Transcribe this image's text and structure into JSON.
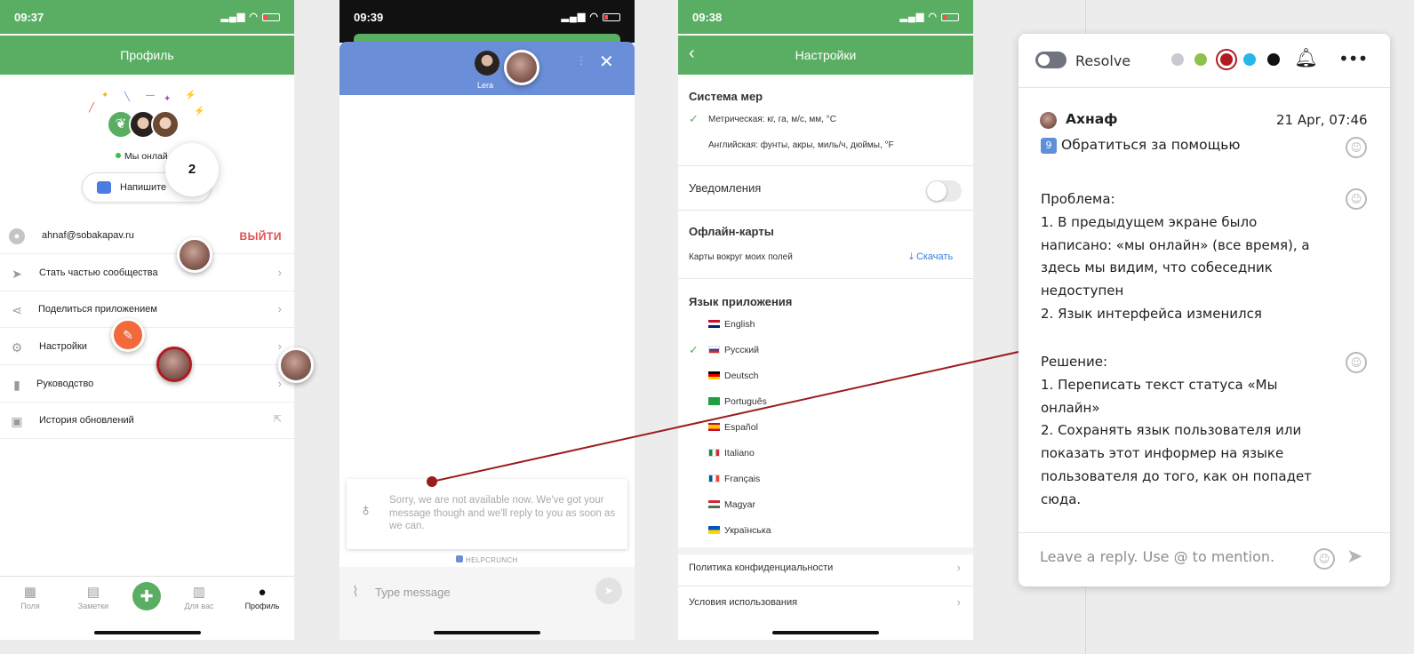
{
  "screen1": {
    "time": "09:37",
    "title": "Профиль",
    "online": "Мы онлай",
    "write_button": "Напишите",
    "badge": "2",
    "email": "ahnaf@sobakapav.ru",
    "logout": "ВЫЙТИ",
    "menu": [
      {
        "label": "Стать частью сообщества",
        "icon": "paper-plane-icon"
      },
      {
        "label": "Поделиться приложением",
        "icon": "share-icon"
      },
      {
        "label": "Настройки",
        "icon": "gear-icon"
      },
      {
        "label": "Руководство",
        "icon": "book-icon"
      },
      {
        "label": "История обновлений",
        "icon": "box-icon"
      }
    ],
    "tabs": [
      {
        "label": "Поля",
        "icon": "fields-icon"
      },
      {
        "label": "Заметки",
        "icon": "notes-icon"
      },
      {
        "label": "",
        "icon": "add-icon"
      },
      {
        "label": "Для вас",
        "icon": "for-you-icon"
      },
      {
        "label": "Профиль",
        "icon": "profile-icon"
      }
    ]
  },
  "screen2": {
    "time": "09:39",
    "agent_name": "Lera",
    "notice": "Sorry, we are not available now. We've got your message though and we'll reply to you as soon as we can.",
    "powered": "HELPCRUNCH",
    "input_placeholder": "Type message"
  },
  "screen3": {
    "time": "09:38",
    "title": "Настройки",
    "units_title": "Система мер",
    "units_metric": "Метрическая: кг, га, м/с, мм, °C",
    "units_imperial": "Английская: фунты, акры, миль/ч, дюймы, °F",
    "notifications": "Уведомления",
    "offline_maps": "Офлайн-карты",
    "maps_around": "Карты вокруг моих полей",
    "download": "Скачать",
    "lang_title": "Язык приложения",
    "languages": [
      "English",
      "Русский",
      "Deutsch",
      "Português",
      "Español",
      "Italiano",
      "Français",
      "Magyar",
      "Українська"
    ],
    "privacy": "Политика конфиденциальности",
    "terms": "Условия использования"
  },
  "comment": {
    "resolve": "Resolve",
    "author": "Ахнаф",
    "date": "21 Apr, 07:46",
    "number_emoji": "9",
    "subject": "Обратиться за помощью",
    "problem": [
      "Проблема:",
      "1. В предыдущем экране было",
      "написано: «мы онлайн» (все время), а",
      "здесь мы видим, что собеседник",
      "недоступен",
      "2. Язык интерфейса изменился"
    ],
    "solution": [
      "Решение:",
      "1. Переписать текст статуса «Мы",
      "онлайн»",
      "2. Сохранять язык пользователя или",
      "показать этот информер на языке",
      "пользователя до того, как он попадет",
      "сюда."
    ],
    "reply_placeholder": "Leave a reply. Use @ to mention.",
    "colors": [
      "#c9c9d1",
      "#8bc34a",
      "#b01c22",
      "#29b6e8",
      "#111111"
    ]
  }
}
